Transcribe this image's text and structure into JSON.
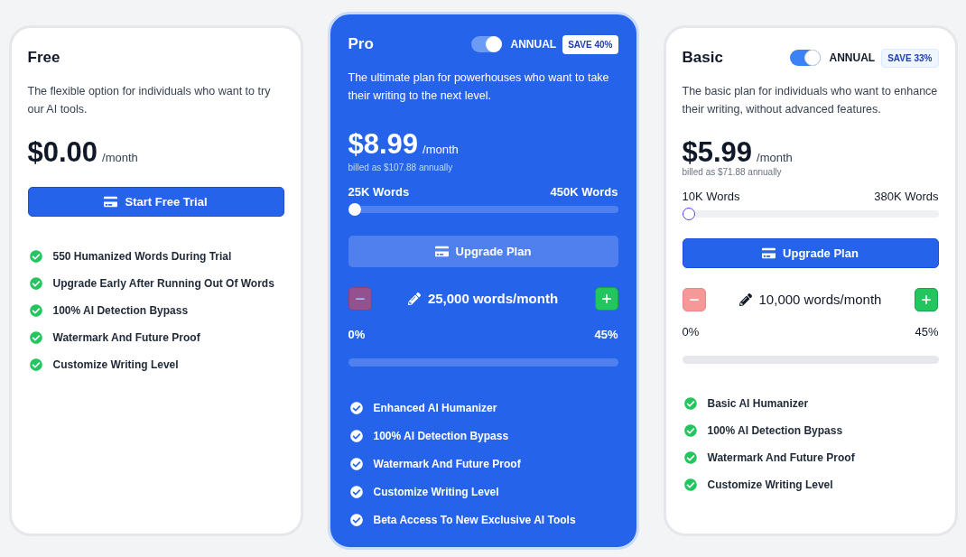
{
  "plans": [
    {
      "name": "Free",
      "highlighted": false,
      "description": "The flexible option for individuals who want to try our AI tools.",
      "price": "$0.00",
      "period": "/month",
      "button": {
        "label": "Start Free Trial"
      },
      "features": [
        "550 Humanized Words During Trial",
        "Upgrade Early After Running Out Of Words",
        "100% AI Detection Bypass",
        "Watermark And Future Proof",
        "Customize Writing Level"
      ]
    },
    {
      "name": "Pro",
      "highlighted": true,
      "billing_toggle": {
        "label": "ANNUAL",
        "on": true
      },
      "badge": "SAVE 40%",
      "description": "The ultimate plan for powerhouses who want to take their writing to the next level.",
      "price": "$8.99",
      "period": "/month",
      "billed": "billed as $107.88 annually",
      "word_slider": {
        "min_label": "25K Words",
        "max_label": "450K Words",
        "level": 0
      },
      "button": {
        "label": "Upgrade Plan"
      },
      "word_stepper": {
        "value": "25,000 words/month",
        "decrease_disabled": true,
        "increase_disabled": false
      },
      "discount_bar": {
        "min_label": "0%",
        "max_label": "45%"
      },
      "features": [
        "Enhanced AI Humanizer",
        "100% AI Detection Bypass",
        "Watermark And Future Proof",
        "Customize Writing Level",
        "Beta Access To New Exclusive AI Tools"
      ]
    },
    {
      "name": "Basic",
      "highlighted": false,
      "billing_toggle": {
        "label": "ANNUAL",
        "on": true
      },
      "badge": "SAVE 33%",
      "description": "The basic plan for individuals who want to enhance their writing, without advanced features.",
      "price": "$5.99",
      "period": "/month",
      "billed": "billed as $71.88 annually",
      "word_slider": {
        "min_label": "10K Words",
        "max_label": "380K Words",
        "level": 0
      },
      "button": {
        "label": "Upgrade Plan"
      },
      "word_stepper": {
        "value": "10,000 words/month",
        "decrease_disabled": true,
        "increase_disabled": false
      },
      "discount_bar": {
        "min_label": "0%",
        "max_label": "45%"
      },
      "features": [
        "Basic AI Humanizer",
        "100% AI Detection Bypass",
        "Watermark And Future Proof",
        "Customize Writing Level"
      ]
    }
  ]
}
